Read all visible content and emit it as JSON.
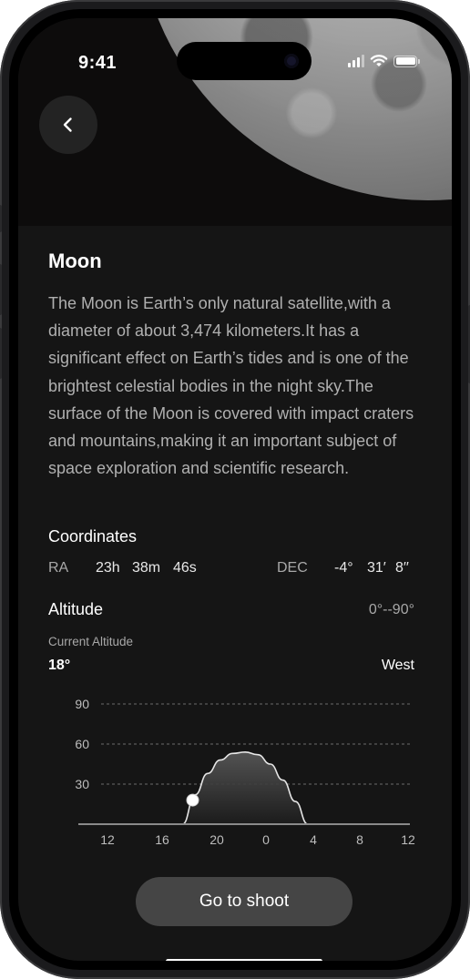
{
  "status_bar": {
    "time": "9:41"
  },
  "object": {
    "name": "Moon",
    "description": "The Moon is Earth’s only natural satellite,with a diameter of about 3,474 kilometers.It has a significant effect on Earth’s tides and is one of the brightest celestial bodies in the night sky.The surface of the Moon is covered with impact craters and mountains,making it an important subject of space exploration and scientific research."
  },
  "coordinates": {
    "heading": "Coordinates",
    "ra_label": "RA",
    "ra_h": "23h",
    "ra_m": "38m",
    "ra_s": "46s",
    "dec_label": "DEC",
    "dec_deg": "-4°",
    "dec_min": "31′",
    "dec_sec": "8′′"
  },
  "altitude": {
    "heading": "Altitude",
    "range": "0°--90°",
    "current_label": "Current Altitude",
    "current_value": "18°",
    "direction": "West"
  },
  "chart_data": {
    "type": "area",
    "x_tick_labels": [
      "12",
      "16",
      "20",
      "0",
      "4",
      "8",
      "12"
    ],
    "y_tick_labels": [
      "90",
      "60",
      "30"
    ],
    "ylim": [
      0,
      90
    ],
    "grid": true,
    "series": [
      {
        "x_hours_from_noon": [
          6,
          7,
          8,
          9,
          10,
          11,
          12,
          13,
          14,
          15,
          16
        ],
        "y": [
          0,
          22,
          38,
          48,
          53,
          54,
          52,
          45,
          33,
          17,
          0
        ]
      }
    ],
    "current_point": {
      "x_hours_from_noon": 6.8,
      "y": 18
    }
  },
  "actions": {
    "shoot_label": "Go to shoot"
  }
}
